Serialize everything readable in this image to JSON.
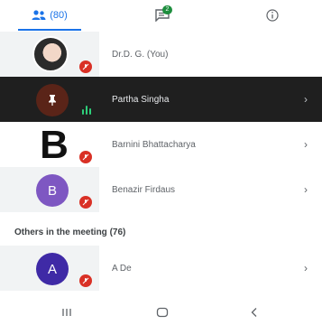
{
  "tabs": {
    "people_label": "(80)",
    "chat_badge": "2"
  },
  "participants": [
    {
      "name": "Dr.D. G. (You)",
      "avatar": ""
    },
    {
      "name": "Partha Singha",
      "avatar": ""
    },
    {
      "name": "Barnini Bhattacharya",
      "avatar": "B"
    },
    {
      "name": "Benazir Firdaus",
      "avatar": "B"
    }
  ],
  "others": {
    "heading": "Others in the meeting (76)",
    "items": [
      {
        "name": "A De",
        "avatar": "A"
      }
    ]
  },
  "colors": {
    "accent": "#1a73e8",
    "muted_badge": "#d93025",
    "speaking": "#2ecf7a"
  }
}
